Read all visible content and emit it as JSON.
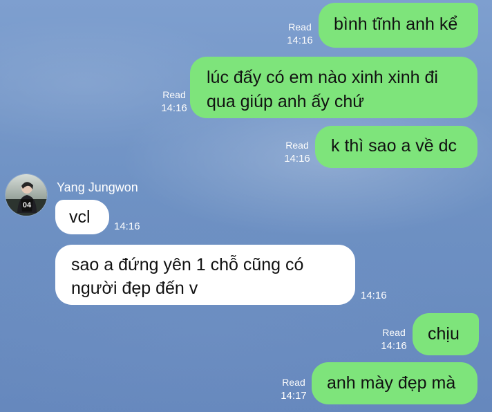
{
  "chat": {
    "messages": [
      {
        "side": "outgoing",
        "text": "bình tĩnh anh kể",
        "read": "Read",
        "time": "14:16"
      },
      {
        "side": "outgoing",
        "lines": [
          "lúc đấy có em nào xinh xinh đi",
          "qua giúp anh ấy chứ"
        ],
        "read": "Read",
        "time": "14:16"
      },
      {
        "side": "outgoing",
        "text": "k thì sao a về dc",
        "read": "Read",
        "time": "14:16"
      },
      {
        "side": "incoming",
        "sender": "Yang Jungwon",
        "text": "vcl",
        "time": "14:16"
      },
      {
        "side": "incoming",
        "lines": [
          "sao a đứng yên 1 chỗ cũng có",
          "người đẹp đến v"
        ],
        "time": "14:16"
      },
      {
        "side": "outgoing",
        "text": "chịu",
        "read": "Read",
        "time": "14:16"
      },
      {
        "side": "outgoing",
        "text": "anh mày đẹp mà",
        "read": "Read",
        "time": "14:17"
      }
    ]
  },
  "avatar": {
    "icon": "profile-avatar-icon",
    "jersey_text": "04"
  },
  "colors": {
    "background": "#6f92c4",
    "outgoing_bubble": "#7ee47b",
    "incoming_bubble": "#ffffff",
    "meta_text": "#ffffff"
  }
}
